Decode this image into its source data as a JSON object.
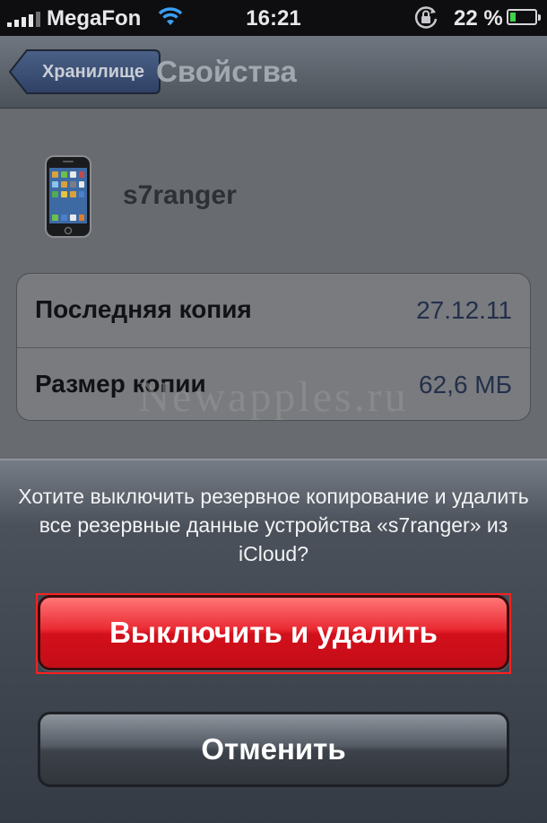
{
  "status_bar": {
    "carrier": "MegaFon",
    "time": "16:21",
    "battery_percent": "22 %",
    "battery_level": 0.22,
    "icons": [
      "signal-bars-icon",
      "wifi-icon",
      "orientation-lock-icon",
      "battery-icon"
    ]
  },
  "nav": {
    "back_label": "Хранилище",
    "title": "Свойства"
  },
  "device": {
    "name": "s7ranger",
    "icon": "iphone-icon"
  },
  "info": {
    "rows": [
      {
        "label": "Последняя копия",
        "value": "27.12.11"
      },
      {
        "label": "Размер копии",
        "value": "62,6 МБ"
      }
    ]
  },
  "watermark": "Newapples.ru",
  "sheet": {
    "message": "Хотите выключить резервное копирование и удалить все резервные данные устройства «s7ranger» из iCloud?",
    "destructive_label": "Выключить и удалить",
    "cancel_label": "Отменить"
  },
  "colors": {
    "destructive": "#e0212b",
    "highlight": "#ff2020",
    "battery": "#3fd34a"
  }
}
